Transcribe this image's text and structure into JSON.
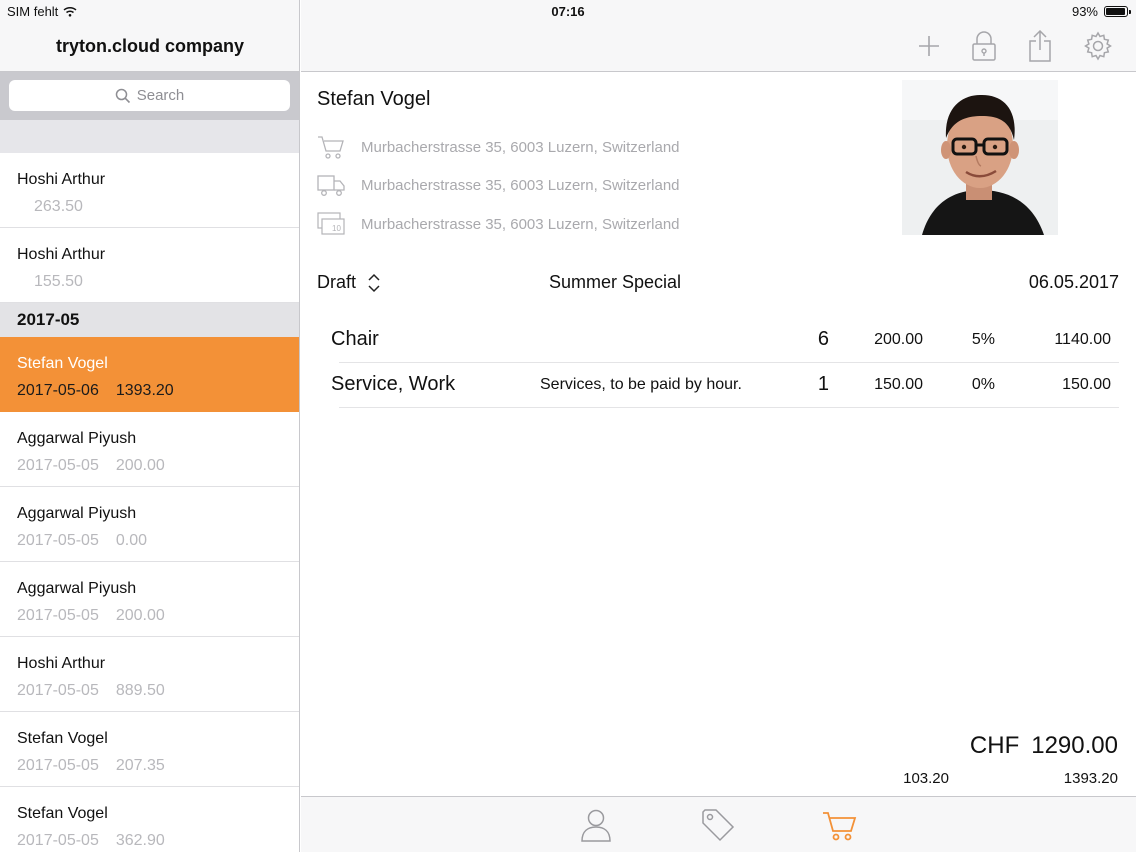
{
  "status_bar": {
    "carrier": "SIM fehlt",
    "time": "07:16",
    "battery": "93%",
    "battery_level": 0.93
  },
  "sidebar": {
    "company": "tryton.cloud company",
    "search_placeholder": "Search",
    "items_top": [
      {
        "name": "Hoshi Arthur",
        "amount": "263.50"
      },
      {
        "name": "Hoshi Arthur",
        "amount": "155.50"
      }
    ],
    "section": "2017-05",
    "items": [
      {
        "name": "Stefan Vogel",
        "date": "2017-05-06",
        "amount": "1393.20"
      },
      {
        "name": "Aggarwal Piyush",
        "date": "2017-05-05",
        "amount": "200.00"
      },
      {
        "name": "Aggarwal Piyush",
        "date": "2017-05-05",
        "amount": "0.00"
      },
      {
        "name": "Aggarwal Piyush",
        "date": "2017-05-05",
        "amount": "200.00"
      },
      {
        "name": "Hoshi Arthur",
        "date": "2017-05-05",
        "amount": "889.50"
      },
      {
        "name": "Stefan Vogel",
        "date": "2017-05-05",
        "amount": "207.35"
      },
      {
        "name": "Stefan Vogel",
        "date": "2017-05-05",
        "amount": "362.90"
      }
    ]
  },
  "toolbar": {
    "icons": [
      "plus-icon",
      "lock-icon",
      "share-icon",
      "gear-icon"
    ]
  },
  "order": {
    "party": "Stefan Vogel",
    "invoice_address": "Murbacherstrasse 35, 6003 Luzern, Switzerland",
    "shipment_address": "Murbacherstrasse 35, 6003 Luzern, Switzerland",
    "billing_address": "Murbacherstrasse 35, 6003 Luzern, Switzerland",
    "billing_icon_label": "10",
    "state": "Draft",
    "description": "Summer Special",
    "date": "06.05.2017",
    "lines": [
      {
        "product": "Chair",
        "description": "",
        "quantity": "6",
        "unit_price": "200.00",
        "discount": "5%",
        "amount": "1140.00"
      },
      {
        "product": "Service, Work",
        "description": "Services, to be paid by hour.",
        "quantity": "1",
        "unit_price": "150.00",
        "discount": "0%",
        "amount": "150.00"
      }
    ],
    "currency": "CHF",
    "untaxed_amount": "1290.00",
    "tax_amount": "103.20",
    "total_amount": "1393.20"
  },
  "tabs": [
    {
      "icon": "person-icon",
      "active": false
    },
    {
      "icon": "tag-icon",
      "active": false
    },
    {
      "icon": "cart-icon",
      "active": true
    }
  ],
  "colors": {
    "accent": "#f39137",
    "muted_text": "#b8b8bc",
    "icon_gray": "#a6a6aa"
  }
}
